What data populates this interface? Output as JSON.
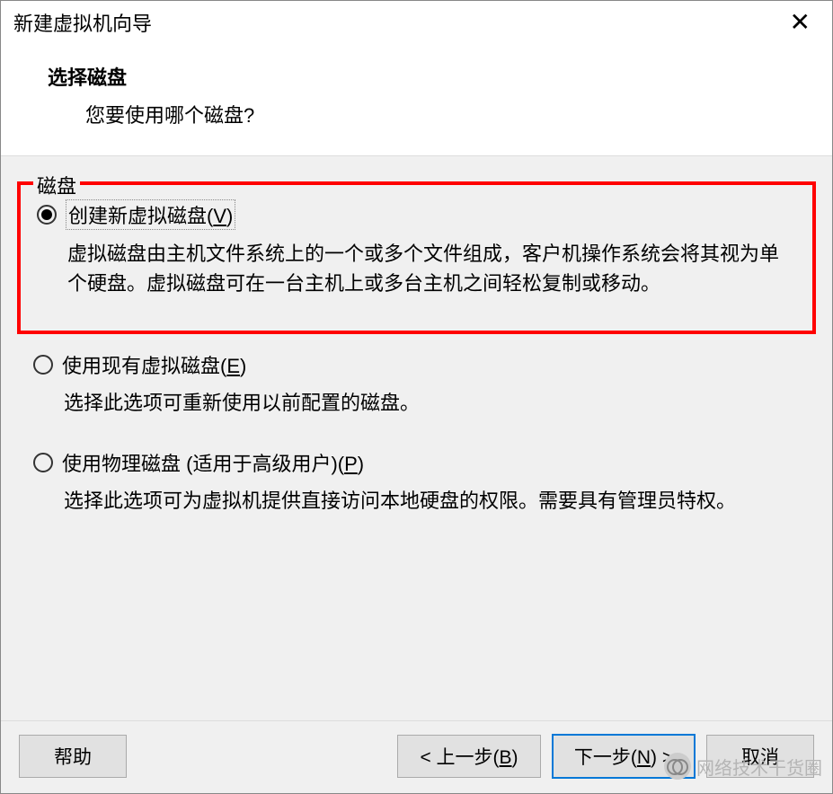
{
  "dialog": {
    "title": "新建虚拟机向导",
    "header_title": "选择磁盘",
    "header_subtitle": "您要使用哪个磁盘?"
  },
  "fieldset": {
    "label": "磁盘"
  },
  "options": [
    {
      "label_prefix": "创建新虚拟磁盘(",
      "label_hotkey": "V",
      "label_suffix": ")",
      "description": "虚拟磁盘由主机文件系统上的一个或多个文件组成，客户机操作系统会将其视为单个硬盘。虚拟磁盘可在一台主机上或多台主机之间轻松复制或移动。",
      "selected": true
    },
    {
      "label_prefix": "使用现有虚拟磁盘(",
      "label_hotkey": "E",
      "label_suffix": ")",
      "description": "选择此选项可重新使用以前配置的磁盘。",
      "selected": false
    },
    {
      "label_prefix": "使用物理磁盘 (适用于高级用户)(",
      "label_hotkey": "P",
      "label_suffix": ")",
      "description": "选择此选项可为虚拟机提供直接访问本地硬盘的权限。需要具有管理员特权。",
      "selected": false
    }
  ],
  "buttons": {
    "help": "帮助",
    "back_prefix": "< 上一步(",
    "back_hotkey": "B",
    "back_suffix": ")",
    "next_prefix": "下一步(",
    "next_hotkey": "N",
    "next_suffix": ") >",
    "cancel": "取消"
  },
  "watermark": {
    "text": "网络技术干货圈"
  }
}
